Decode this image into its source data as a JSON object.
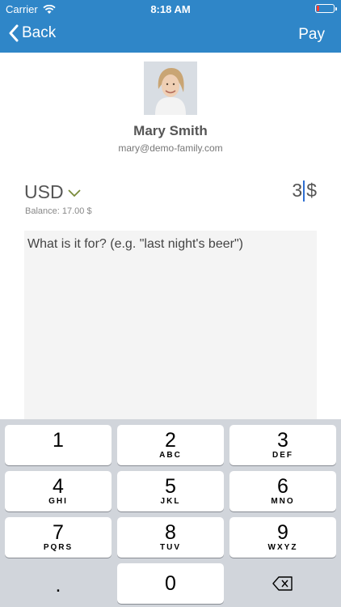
{
  "status_bar": {
    "carrier": "Carrier",
    "time": "8:18 AM",
    "battery_level": 0.1
  },
  "nav": {
    "back_label": "Back",
    "action_label": "Pay"
  },
  "profile": {
    "name": "Mary Smith",
    "email": "mary@demo-family.com",
    "avatar_icon": "person-photo"
  },
  "payment": {
    "currency": "USD",
    "balance": "Balance: 17.00 $",
    "amount": "3",
    "amount_suffix": "$",
    "note_placeholder": "What is it for? (e.g. \"last night's beer\")"
  },
  "keypad": {
    "keys": [
      {
        "num": "1",
        "letters": ""
      },
      {
        "num": "2",
        "letters": "ABC"
      },
      {
        "num": "3",
        "letters": "DEF"
      },
      {
        "num": "4",
        "letters": "GHI"
      },
      {
        "num": "5",
        "letters": "JKL"
      },
      {
        "num": "6",
        "letters": "MNO"
      },
      {
        "num": "7",
        "letters": "PQRS"
      },
      {
        "num": "8",
        "letters": "TUV"
      },
      {
        "num": "9",
        "letters": "WXYZ"
      },
      {
        "num": ".",
        "letters": ""
      },
      {
        "num": "0",
        "letters": ""
      }
    ],
    "delete_icon": "backspace-icon"
  },
  "colors": {
    "nav_bar": "#2f86c8",
    "keypad_bg": "#d1d5db",
    "caret": "#2f6fd1",
    "chevron": "#7a8a3a"
  }
}
